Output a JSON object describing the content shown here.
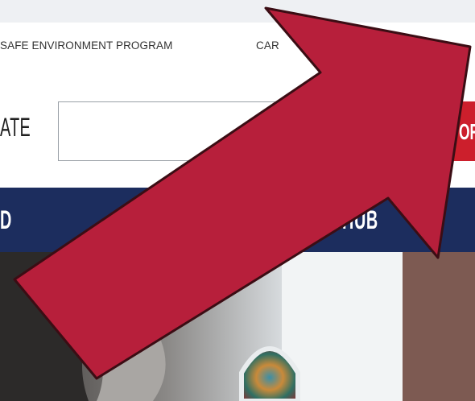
{
  "utility_nav": {
    "items": [
      {
        "label": "SAFE ENVIRONMENT PROGRAM"
      },
      {
        "label": "CAR"
      }
    ]
  },
  "header": {
    "donate_label": "ATE",
    "search": {
      "value": "",
      "placeholder": ""
    },
    "red_button_label": "OR"
  },
  "main_nav": {
    "items": [
      {
        "label": "D"
      },
      {
        "label": "HUB"
      }
    ]
  },
  "colors": {
    "nav_background": "#1c2d5e",
    "accent_red": "#cc1f2c",
    "arrow_fill": "#b71f3b",
    "arrow_outline": "#3b0d14"
  },
  "icons": {
    "overlay": "arrow-up-right-icon"
  }
}
